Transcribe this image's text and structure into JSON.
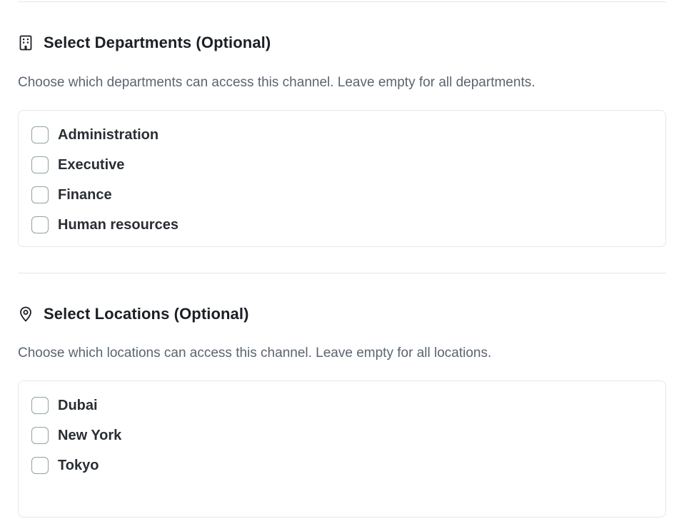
{
  "departments": {
    "title": "Select Departments (Optional)",
    "icon": "building-icon",
    "description": "Choose which departments can access this channel. Leave empty for all departments.",
    "options": [
      {
        "label": "Administration",
        "checked": false
      },
      {
        "label": "Executive",
        "checked": false
      },
      {
        "label": "Finance",
        "checked": false
      },
      {
        "label": "Human resources",
        "checked": false
      }
    ]
  },
  "locations": {
    "title": "Select Locations (Optional)",
    "icon": "map-pin-icon",
    "description": "Choose which locations can access this channel. Leave empty for all locations.",
    "options": [
      {
        "label": "Dubai",
        "checked": false
      },
      {
        "label": "New York",
        "checked": false
      },
      {
        "label": "Tokyo",
        "checked": false
      }
    ]
  },
  "colors": {
    "text": "#1c1f24",
    "muted": "#5b6470",
    "border": "#e5e7eb",
    "checkbox_border": "#8fa39b"
  }
}
